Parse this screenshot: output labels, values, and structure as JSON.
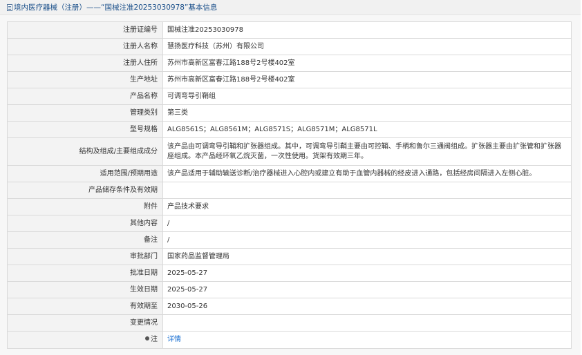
{
  "header": {
    "title": "境内医疗器械（注册）——“国械注准20253030978”基本信息"
  },
  "rows": [
    {
      "label": "注册证编号",
      "value": "国械注准20253030978"
    },
    {
      "label": "注册人名称",
      "value": "慧扬医疗科技（苏州）有限公司"
    },
    {
      "label": "注册人住所",
      "value": "苏州市高新区富春江路188号2号楼402室"
    },
    {
      "label": "生产地址",
      "value": "苏州市高新区富春江路188号2号楼402室"
    },
    {
      "label": "产品名称",
      "value": "可调弯导引鞘组"
    },
    {
      "label": "管理类别",
      "value": "第三类"
    },
    {
      "label": "型号规格",
      "value": "ALG8561S；ALG8561M；ALG8571S；ALG8571M；ALG8571L"
    },
    {
      "label": "结构及组成/主要组成成分",
      "value": "该产品由可调弯导引鞘和扩张器组成。其中，可调弯导引鞘主要由可控鞘、手柄和鲁尔三通阀组成。扩张器主要由扩张管和扩张器座组成。本产品经环氧乙烷灭菌，一次性使用。货架有效期三年。"
    },
    {
      "label": "适用范围/预期用途",
      "value": "该产品适用于辅助输送诊断/治疗器械进入心腔内或建立有助于血管内器械的经皮进入通路，包括经房间隔进入左侧心脏。"
    },
    {
      "label": "产品储存条件及有效期",
      "value": ""
    },
    {
      "label": "附件",
      "value": "产品技术要求"
    },
    {
      "label": "其他内容",
      "value": "/"
    },
    {
      "label": "备注",
      "value": "/"
    },
    {
      "label": "审批部门",
      "value": "国家药品监督管理局"
    },
    {
      "label": "批准日期",
      "value": "2025-05-27"
    },
    {
      "label": "生效日期",
      "value": "2025-05-27"
    },
    {
      "label": "有效期至",
      "value": "2030-05-26"
    },
    {
      "label": "变更情况",
      "value": ""
    },
    {
      "label": "注",
      "value": "详情"
    }
  ]
}
